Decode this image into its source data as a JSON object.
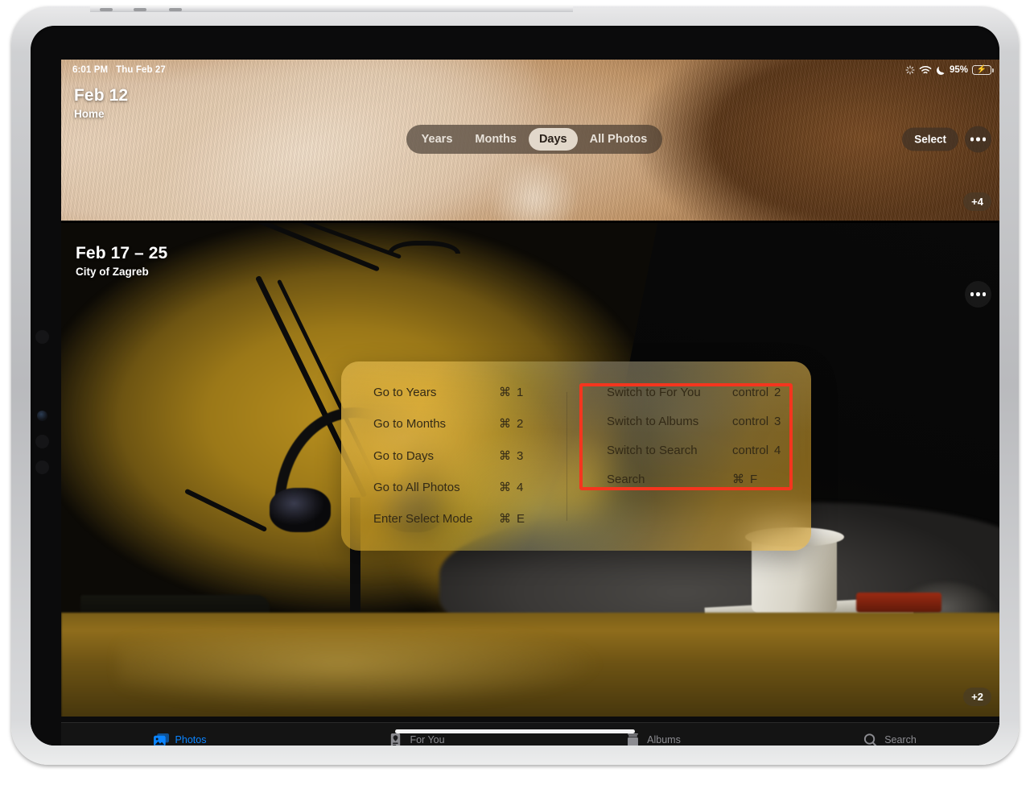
{
  "status_bar": {
    "time": "6:01 PM",
    "date": "Thu Feb 27",
    "battery_percent": "95%",
    "icons": [
      "airdrop-icon",
      "wifi-icon",
      "moon-icon",
      "battery-charging-icon"
    ]
  },
  "nav": {
    "segments": [
      {
        "label": "Years",
        "active": false
      },
      {
        "label": "Months",
        "active": false
      },
      {
        "label": "Days",
        "active": true
      },
      {
        "label": "All Photos",
        "active": false
      }
    ],
    "select_label": "Select",
    "more_icon": "ellipsis-icon"
  },
  "photo_groups": [
    {
      "title": "Feb 12",
      "subtitle": "Home",
      "badge": "+4",
      "scene": "close-up of brown and white cat fur"
    },
    {
      "title": "Feb 17 – 25",
      "subtitle": "City of Zagreb",
      "badge": "+2",
      "more_icon": "ellipsis-icon",
      "scene": "desk with microphone boom arm, headphones on stand, grey cat lying on desk, warm lamp light"
    }
  ],
  "shortcut_overlay": {
    "left_column": [
      {
        "label": "Go to Years",
        "modifier": "⌘",
        "key": "1"
      },
      {
        "label": "Go to Months",
        "modifier": "⌘",
        "key": "2"
      },
      {
        "label": "Go to Days",
        "modifier": "⌘",
        "key": "3"
      },
      {
        "label": "Go to All Photos",
        "modifier": "⌘",
        "key": "4"
      },
      {
        "label": "Enter Select Mode",
        "modifier": "⌘",
        "key": "E"
      }
    ],
    "right_column": [
      {
        "label": "Switch to For You",
        "modifier": "control",
        "key": "2"
      },
      {
        "label": "Switch to Albums",
        "modifier": "control",
        "key": "3"
      },
      {
        "label": "Switch to Search",
        "modifier": "control",
        "key": "4"
      },
      {
        "label": "Search",
        "modifier": "⌘",
        "key": "F"
      }
    ],
    "highlight_color": "#f4351e"
  },
  "tab_bar": {
    "accent_color": "#0a84ff",
    "inactive_color": "#8c8c91",
    "items": [
      {
        "label": "Photos",
        "icon": "photos-stack-icon",
        "active": true
      },
      {
        "label": "For You",
        "icon": "for-you-card-icon",
        "active": false
      },
      {
        "label": "Albums",
        "icon": "albums-book-icon",
        "active": false
      },
      {
        "label": "Search",
        "icon": "magnifier-icon",
        "active": false
      }
    ]
  }
}
